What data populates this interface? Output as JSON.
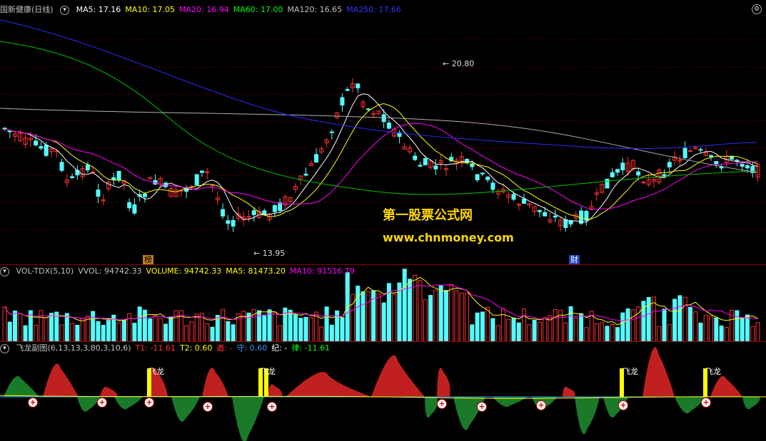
{
  "main": {
    "title": "国新健康(日线)",
    "ma_labels": [
      {
        "text": "MA5: 17.16",
        "color": "#ffffff"
      },
      {
        "text": "MA10: 17.05",
        "color": "#ffff00"
      },
      {
        "text": "MA20: 16.94",
        "color": "#ff00ff"
      },
      {
        "text": "MA60: 17.00",
        "color": "#00ff00"
      },
      {
        "text": "MA120: 16.65",
        "color": "#c0c0c0"
      },
      {
        "text": "MA250: 17.66",
        "color": "#3333ff"
      }
    ],
    "high_label": "20.80",
    "low_label": "13.95",
    "tag_left": "榜",
    "tag_right": "财"
  },
  "watermark": {
    "line1": "第一股票公式网",
    "line2": "www.chnmoney.com"
  },
  "volume": {
    "header": [
      {
        "text": "VOL-TDX(5,10)",
        "color": "#c0c0c0"
      },
      {
        "text": "VVOL: 94742.33",
        "color": "#c0c0c0"
      },
      {
        "text": "VOLUME: 94742.33",
        "color": "#ffff00"
      },
      {
        "text": "MA5: 81473.20",
        "color": "#ffff00"
      },
      {
        "text": "MA10: 91516.79",
        "color": "#ff00ff"
      }
    ]
  },
  "feilong": {
    "header": [
      {
        "text": "飞龙副图(6,13,13,3,80,3,10,6)",
        "color": "#c0c0c0"
      },
      {
        "text": "T1: -11.61",
        "color": "#ff3030"
      },
      {
        "text": "T2: 0.60",
        "color": "#ffff00"
      },
      {
        "text": "邀: -",
        "color": "#ff3030"
      },
      {
        "text": "守: 0.60",
        "color": "#3399ff"
      },
      {
        "text": "纪: -",
        "color": "#ffffff"
      },
      {
        "text": "律: -11.61",
        "color": "#00ff00"
      }
    ],
    "signal_label": "飞龙",
    "plus": "+"
  },
  "colors": {
    "up": "#ff3030",
    "down": "#54fcfc",
    "grid": "#8b0000"
  }
}
